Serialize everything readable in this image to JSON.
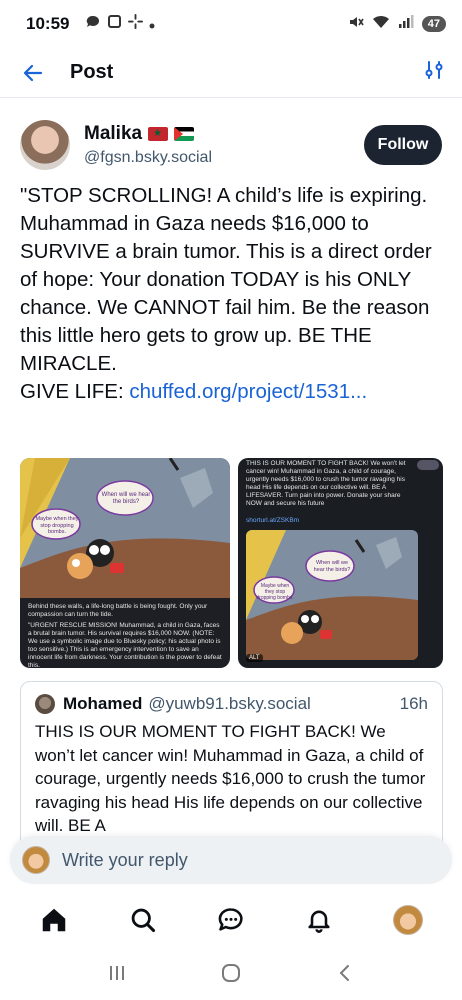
{
  "status": {
    "time": "10:59",
    "battery": "47",
    "icons": [
      "chat-bubble-icon",
      "square-icon",
      "pinwheel-icon",
      "dot-icon",
      "mute-icon",
      "wifi-icon",
      "signal-icon",
      "battery-icon"
    ]
  },
  "header": {
    "title": "Post",
    "back_icon": "arrow-left-icon",
    "filter_icon": "sliders-icon"
  },
  "author": {
    "name": "Malika",
    "flags": [
      "morocco-flag",
      "palestine-flag"
    ],
    "handle": "@fgsn.bsky.social",
    "follow_label": "Follow"
  },
  "post": {
    "text": "\"STOP SCROLLING! A child’s life is expiring. Muhammad in Gaza needs $16,000 to SURVIVE a brain tumor. This is a direct order of hope: Your donation TODAY is his ONLY chance. We CANNOT fail him. Be the reason this little hero gets to grow up. BE THE MIRACLE.\nGIVE LIFE: ",
    "link": "chuffed.org/project/1531...",
    "image1": {
      "bubble1": "When will we hear the birds?",
      "bubble2": "Maybe when they stop dropping bombs.",
      "caption1": "Behind these walls, a life-long battle is being fought. Only your compassion can turn the tide.",
      "caption2": "\"URGENT RESCUE MISSION! Muhammad, a child in Gaza, faces a brutal brain tumor. His survival requires $16,000 NOW. (NOTE: We use a symbolic image due to Bluesky policy; his actual photo is too sensitive.) This is an emergency intervention to save an innocent life from darkness. Your contribution is the power to defeat this."
    },
    "image2": {
      "caption": "THIS IS OUR MOMENT TO FIGHT BACK! We won't let cancer win! Muhammad in Gaza, a child of courage, urgently needs $16,000 to crush the tumor ravaging his head His life depends on our collective will. BE A LIFESAVER. Turn pain into power. Donate your share NOW and secure his future",
      "link": "shorturl.at/ZSKBm",
      "bubble1": "When will we hear the birds?",
      "bubble2": "Maybe when they stop dropping bombs.",
      "alt": "ALT"
    }
  },
  "quote": {
    "name": "Mohamed",
    "handle": "@yuwb91.bsky.social",
    "time": "16h",
    "text": "THIS IS OUR MOMENT TO FIGHT BACK! We won’t let cancer win! Muhammad in Gaza, a child of courage, urgently needs $16,000 to crush the tumor ravaging his head His life depends on our collective will. BE A"
  },
  "reply": {
    "placeholder": "Write your reply"
  },
  "nav": [
    "home-icon",
    "search-icon",
    "chat-icon",
    "notifications-icon",
    "profile-avatar"
  ],
  "colors": {
    "accent": "#1a63d6",
    "text": "#0b0f14",
    "muted": "#42576c",
    "follow_bg": "#1b2430"
  }
}
